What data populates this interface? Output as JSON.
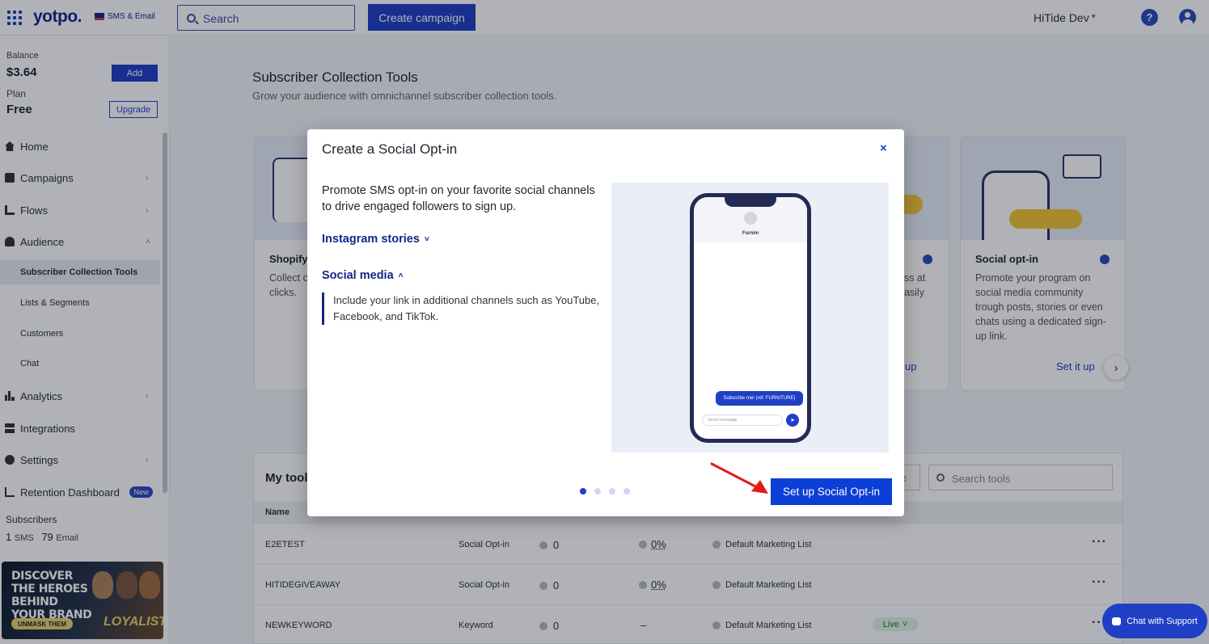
{
  "topbar": {
    "logo": "yotpo.",
    "logo_sub": "SMS & Email",
    "search_label": "Search",
    "create_campaign": "Create campaign",
    "account": "HiTide Dev",
    "help": "?"
  },
  "sidebar": {
    "balance_label": "Balance",
    "balance_value": "$3.64",
    "add": "Add",
    "plan_label": "Plan",
    "plan_value": "Free",
    "upgrade": "Upgrade",
    "items": [
      {
        "label": "Home",
        "icon": "home-icon"
      },
      {
        "label": "Campaigns",
        "icon": "campaigns-icon"
      },
      {
        "label": "Flows",
        "icon": "flows-icon"
      },
      {
        "label": "Audience",
        "icon": "audience-icon"
      },
      {
        "label": "Subscriber Collection Tools"
      },
      {
        "label": "Lists & Segments"
      },
      {
        "label": "Customers"
      },
      {
        "label": "Chat"
      },
      {
        "label": "Analytics",
        "icon": "analytics-icon"
      },
      {
        "label": "Integrations",
        "icon": "integrations-icon"
      },
      {
        "label": "Settings",
        "icon": "settings-icon"
      },
      {
        "label": "Retention Dashboard",
        "icon": "retention-icon",
        "badge": "New"
      }
    ],
    "subscribers_label": "Subscribers",
    "sms_count": "1",
    "sms_label": "SMS",
    "email_count": "79",
    "email_label": "Email",
    "promo": {
      "title": "DISCOVER THE HEROES BEHIND YOUR BRAND",
      "cta": "UNMASK THEM",
      "brand": "LOYALISTS"
    }
  },
  "main": {
    "title": "Subscriber Collection Tools",
    "subtitle": "Grow your audience with omnichannel subscriber collection tools.",
    "cards": [
      {
        "title": "Shopify",
        "desc": "Collect consent checkout clicks."
      },
      {
        "title": "",
        "desc": "oss at easily",
        "link": "up"
      },
      {
        "title": "Social opt-in",
        "desc": "Promote your program on social media community trough posts, stories or even chats using a dedicated sign-up link.",
        "link": "Set it up"
      }
    ],
    "tools": {
      "title": "My tool",
      "filter_stub": "e",
      "search_placeholder": "Search tools",
      "col_name": "Name",
      "rows": [
        {
          "name": "E2ETEST",
          "type": "Social Opt-in",
          "count": "0",
          "pct": "0%",
          "list": "Default Marketing List",
          "status": ""
        },
        {
          "name": "HITIDEGIVEAWAY",
          "type": "Social Opt-in",
          "count": "0",
          "pct": "0%",
          "list": "Default Marketing List",
          "status": ""
        },
        {
          "name": "NEWKEYWORD",
          "type": "Keyword",
          "count": "0",
          "pct": "–",
          "list": "Default Marketing List",
          "status": "Live"
        }
      ]
    }
  },
  "chat_support": "Chat with Support",
  "modal": {
    "title": "Create a Social Opt-in",
    "close": "×",
    "description": "Promote SMS opt-in on your favorite social channels to drive engaged followers to sign up.",
    "accordion_1": "Instagram stories",
    "accordion_2": "Social media",
    "accordion_2_body": "Include your link in additional channels such as YouTube, Facebook, and TikTok.",
    "phone_name": "Furnim",
    "phone_message": "Subscribe me! (ref: FURNITURE)",
    "phone_input_placeholder": "Send message",
    "carousel_active": 1,
    "carousel_total": 4,
    "cta": "Set up Social Opt-in"
  },
  "colors": {
    "brand": "#1f3fc4",
    "brand_dark": "#12278a",
    "cta": "#0b3fd6",
    "annotation_arrow": "#e01b1b"
  }
}
